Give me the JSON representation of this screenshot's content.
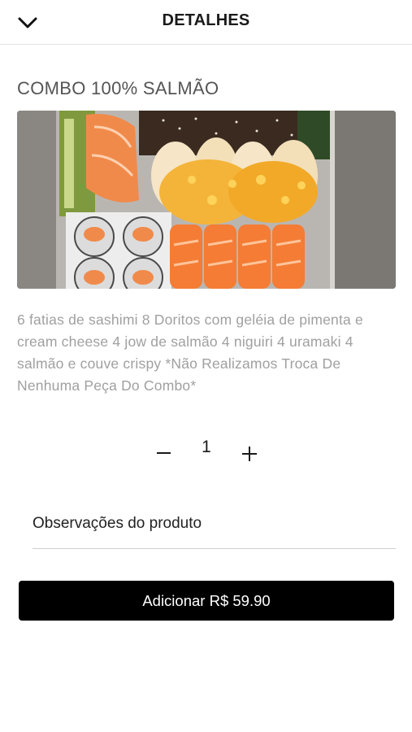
{
  "header": {
    "title": "DETALHES",
    "back_icon": "chevron-down-icon"
  },
  "product": {
    "name": "COMBO 100% SALMÃO",
    "description": "6 fatias de sashimi 8 Doritos com geléia de pimenta e cream cheese 4 jow de salmão 4 niguiri 4 uramaki 4 salmão e couve crispy *Não Realizamos Troca De Nenhuma Peça Do Combo*"
  },
  "quantity": {
    "value": "1",
    "minus_icon": "minus-icon",
    "plus_icon": "plus-icon"
  },
  "observations": {
    "label": "Observações do produto"
  },
  "add_button": {
    "label": "Adicionar R$ 59.90"
  },
  "colors": {
    "button_bg": "#000000",
    "button_text": "#ffffff",
    "description_text": "#a0a0a0",
    "salmon": "#f2793a"
  }
}
